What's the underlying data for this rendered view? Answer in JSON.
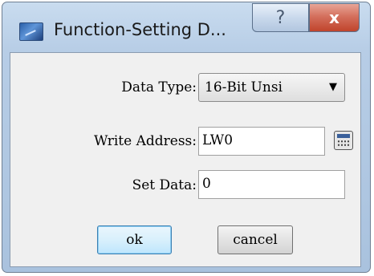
{
  "window": {
    "title": "Function-Setting D...",
    "help_label": "?",
    "close_label": "x"
  },
  "form": {
    "data_type_label": "Data Type:",
    "data_type_value": "16-Bit Unsi",
    "write_address_label": "Write Address:",
    "write_address_value": "LW0",
    "set_data_label": "Set Data:",
    "set_data_value": "0"
  },
  "buttons": {
    "ok_label": "ok",
    "cancel_label": "cancel"
  },
  "icons": {
    "app": "app-window-icon",
    "dropdown": "chevron-down-icon",
    "calculator": "calculator-icon"
  }
}
